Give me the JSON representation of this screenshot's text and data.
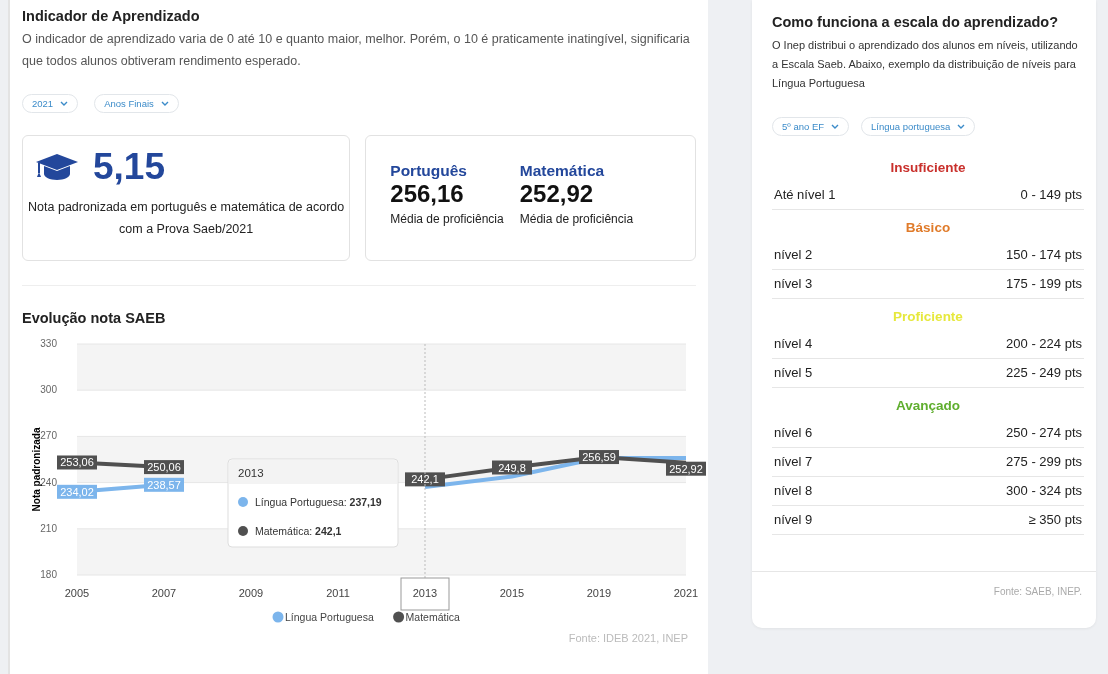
{
  "indicator": {
    "title": "Indicador de Aprendizado",
    "description": "O indicador de aprendizado varia de 0 até 10 e quanto maior, melhor. Porém, o 10 é praticamente inatingível, significaria que todos alunos obtiveram rendimento esperado.",
    "filters": [
      "2021",
      "Anos Finais"
    ],
    "score": {
      "value": "5,15",
      "caption": "Nota padronizada em português e matemática de acordo com a Prova Saeb/2021"
    },
    "subjects": [
      {
        "name": "Português",
        "value": "256,16",
        "caption": "Média de proficiência"
      },
      {
        "name": "Matemática",
        "value": "252,92",
        "caption": "Média de proficiência"
      }
    ]
  },
  "evolution": {
    "title": "Evolução nota SAEB",
    "source": "Fonte: IDEB 2021, INEP",
    "chart_data": {
      "type": "line",
      "ylabel": "Nota padronizada",
      "categories": [
        "2005",
        "2007",
        "2009",
        "2011",
        "2013",
        "2015",
        "2019",
        "2021"
      ],
      "grid": true,
      "legend": true,
      "ylim": [
        180,
        330
      ],
      "yticks": [
        180,
        210,
        240,
        270,
        300,
        330
      ],
      "series": [
        {
          "name": "Língua Portuguesa",
          "color": "#7cb5ec",
          "values": [
            234.02,
            238.57,
            null,
            null,
            237.2,
            244,
            256,
            256
          ],
          "value_labels": [
            "234,02",
            "238,57",
            null,
            null,
            null,
            null,
            null,
            null
          ]
        },
        {
          "name": "Matemática",
          "color": "#505050",
          "marker": "square",
          "values": [
            253.06,
            250.06,
            null,
            null,
            242.1,
            249.8,
            256.59,
            252.92
          ],
          "value_labels": [
            "253,06",
            "250,06",
            null,
            null,
            "242,1",
            "249,8",
            "256,59",
            "252,92"
          ]
        }
      ]
    },
    "tooltip": {
      "title": "2013",
      "items": [
        {
          "label": "Língua Portuguesa:",
          "value": "237,19",
          "color": "#7cb5ec"
        },
        {
          "label": "Matemática:",
          "value": "242,1",
          "color": "#505050"
        }
      ]
    }
  },
  "scale": {
    "title": "Como funciona a escala do aprendizado?",
    "description": "O Inep distribui o aprendizado dos alunos em níveis, utilizando a Escala Saeb. Abaixo, exemplo da distribuição de níveis para Língua Portuguesa",
    "filters": [
      "5º ano EF",
      "Língua portuguesa"
    ],
    "groups": [
      {
        "name": "Insuficiente",
        "color": "#c9302c",
        "levels": [
          {
            "label": "Até nível 1",
            "range": "0 - 149 pts"
          }
        ]
      },
      {
        "name": "Básico",
        "color": "#e07b2a",
        "levels": [
          {
            "label": "nível 2",
            "range": "150 - 174 pts"
          },
          {
            "label": "nível 3",
            "range": "175 - 199 pts"
          }
        ]
      },
      {
        "name": "Proficiente",
        "color": "#e6e83c",
        "levels": [
          {
            "label": "nível 4",
            "range": "200 - 224 pts"
          },
          {
            "label": "nível 5",
            "range": "225 - 249 pts"
          }
        ]
      },
      {
        "name": "Avançado",
        "color": "#5fae2e",
        "levels": [
          {
            "label": "nível 6",
            "range": "250 - 274 pts"
          },
          {
            "label": "nível 7",
            "range": "275 - 299 pts"
          },
          {
            "label": "nível 8",
            "range": "300 - 324 pts"
          },
          {
            "label": "nível 9",
            "range": "≥ 350 pts"
          }
        ]
      }
    ],
    "source": "Fonte: SAEB, INEP."
  }
}
